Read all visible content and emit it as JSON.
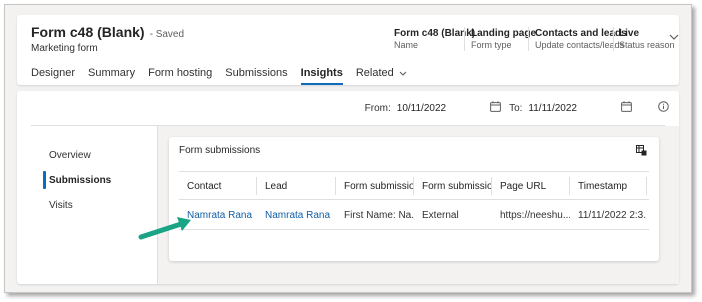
{
  "header": {
    "title": "Form c48 (Blank)",
    "saved": "- Saved",
    "subtitle": "Marketing form",
    "meta": [
      {
        "value": "Form c48 (Blank)",
        "key": "Name"
      },
      {
        "value": "Landing page",
        "key": "Form type"
      },
      {
        "value": "Contacts and leads",
        "key": "Update contacts/leads"
      },
      {
        "value": "Live",
        "key": "Status reason"
      }
    ],
    "tabs": [
      {
        "label": "Designer"
      },
      {
        "label": "Summary"
      },
      {
        "label": "Form hosting"
      },
      {
        "label": "Submissions"
      },
      {
        "label": "Insights",
        "active": true
      },
      {
        "label": "Related"
      }
    ]
  },
  "dates": {
    "from_label": "From:",
    "from_value": "10/11/2022",
    "to_label": "To:",
    "to_value": "11/11/2022"
  },
  "nav": {
    "items": [
      {
        "label": "Overview"
      },
      {
        "label": "Submissions",
        "active": true
      },
      {
        "label": "Visits"
      }
    ]
  },
  "submissions": {
    "title": "Form submissions",
    "columns": [
      "Contact",
      "Lead",
      "Form submissions",
      "Form submission...",
      "Page URL",
      "Timestamp"
    ],
    "rows": [
      [
        "Namrata Rana",
        "Namrata Rana",
        "First Name: Na...",
        "External",
        "https://neeshu....",
        "11/11/2022 2:3..."
      ]
    ]
  },
  "colors": {
    "accent": "#0f6cbd",
    "link": "#115ea3",
    "arrow": "#1aa385"
  }
}
